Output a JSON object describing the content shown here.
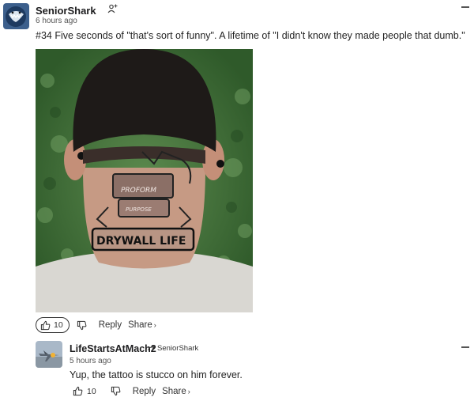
{
  "comment": {
    "author": "SeniorShark",
    "time": "6 hours ago",
    "text": "#34 Five seconds of \"that's sort of funny\". A lifetime of \"I didn't know they made people that dumb.\"",
    "image": {
      "tattoo_lines": [
        "PROFORM",
        "PURPOSE",
        "DRYWALL LIFE"
      ]
    },
    "likes": "10",
    "reply_label": "Reply",
    "share_label": "Share",
    "share_glyph": "›"
  },
  "reply": {
    "author": "LifeStartsAtMach2",
    "replying_to": "SeniorShark",
    "time": "5 hours ago",
    "text": "Yup, the tattoo is stucco on him forever.",
    "likes": "10",
    "reply_label": "Reply",
    "share_label": "Share",
    "share_glyph": "›"
  },
  "icons": {
    "follow": "add-user-icon",
    "menu": "menu-icon",
    "like": "thumbs-up-icon",
    "dislike": "thumbs-down-icon",
    "reply_arrow": "reply-arrow-icon"
  },
  "colors": {
    "accent": "#1d1d1f",
    "muted": "#555555",
    "divider": "#e0e0e0"
  }
}
